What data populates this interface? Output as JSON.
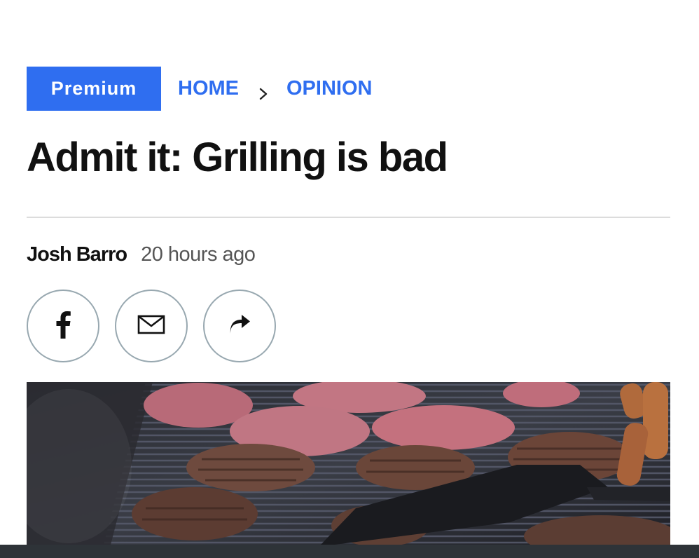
{
  "article": {
    "badge": "Premium",
    "breadcrumb": {
      "home": "HOME",
      "section": "OPINION"
    },
    "title": "Admit it: Grilling is bad",
    "author": "Josh Barro",
    "published": "20 hours ago"
  },
  "share": {
    "facebook_icon": "facebook-icon",
    "email_icon": "email-icon",
    "share_icon": "share-arrow-icon"
  },
  "colors": {
    "accent": "#2f6ef0",
    "title": "#111111",
    "byline_time": "#555555",
    "button_border": "#98a8b0",
    "bottom_bar": "#2e3338"
  }
}
